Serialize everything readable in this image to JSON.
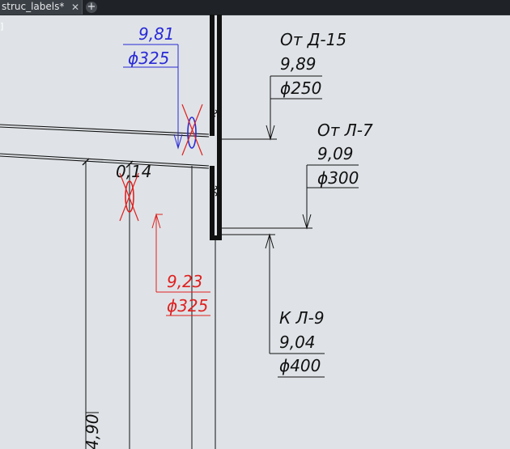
{
  "tab": {
    "title": "struc_labels*",
    "close_glyph": "✕",
    "add_glyph": "+"
  },
  "corner_mark": "]",
  "labels": {
    "blue_level": "9,81",
    "blue_diam": "ϕ325",
    "ot_d15_title": "От Д-15",
    "ot_d15_level": "9,89",
    "ot_d15_diam": "ϕ250",
    "ot_l7_title": "От Л-7",
    "ot_l7_level": "9,09",
    "ot_l7_diam": "ϕ300",
    "slope": "0,14",
    "red_level": "9,23",
    "red_diam": "ϕ325",
    "k_l9_title": "К Л-9",
    "k_l9_level": "9,04",
    "k_l9_diam": "ϕ400",
    "dim_vertical": "4,90"
  },
  "colors": {
    "background": "#dfe3e7",
    "line": "#111111",
    "blue": "#2a2ad6",
    "red": "#e0201f"
  }
}
